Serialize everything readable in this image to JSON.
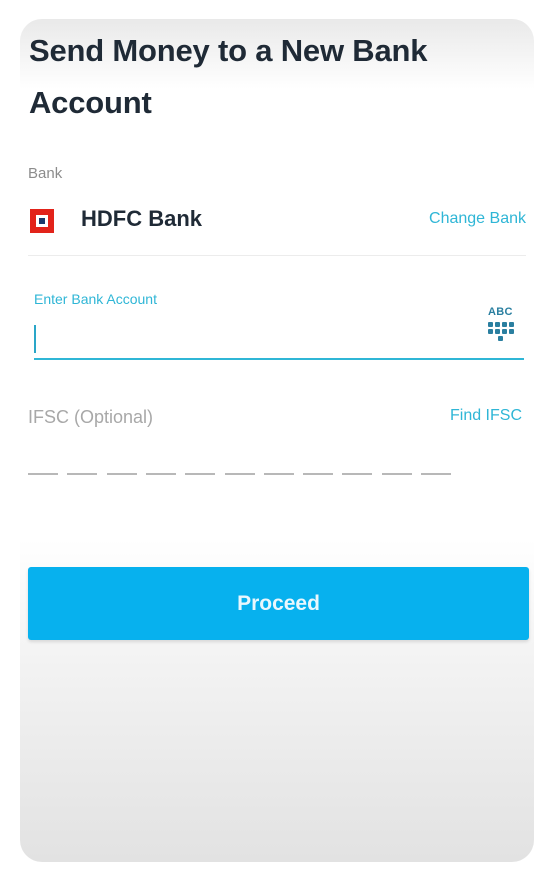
{
  "title": "Send Money to a New Bank Account",
  "bank": {
    "label": "Bank",
    "name": "HDFC Bank",
    "change_label": "Change Bank",
    "logo_icon": "hdfc-logo-icon"
  },
  "account": {
    "label": "Enter Bank Account",
    "value": "",
    "keyboard_toggle_label": "ABC"
  },
  "ifsc": {
    "label": "IFSC (Optional)",
    "find_label": "Find IFSC",
    "slots": 11
  },
  "actions": {
    "proceed_label": "Proceed"
  },
  "colors": {
    "accent": "#2fb6d6",
    "button": "#07b1ee",
    "title": "#1f2a36",
    "hdfc_red": "#e2231a",
    "hdfc_navy": "#1a3a6b"
  }
}
